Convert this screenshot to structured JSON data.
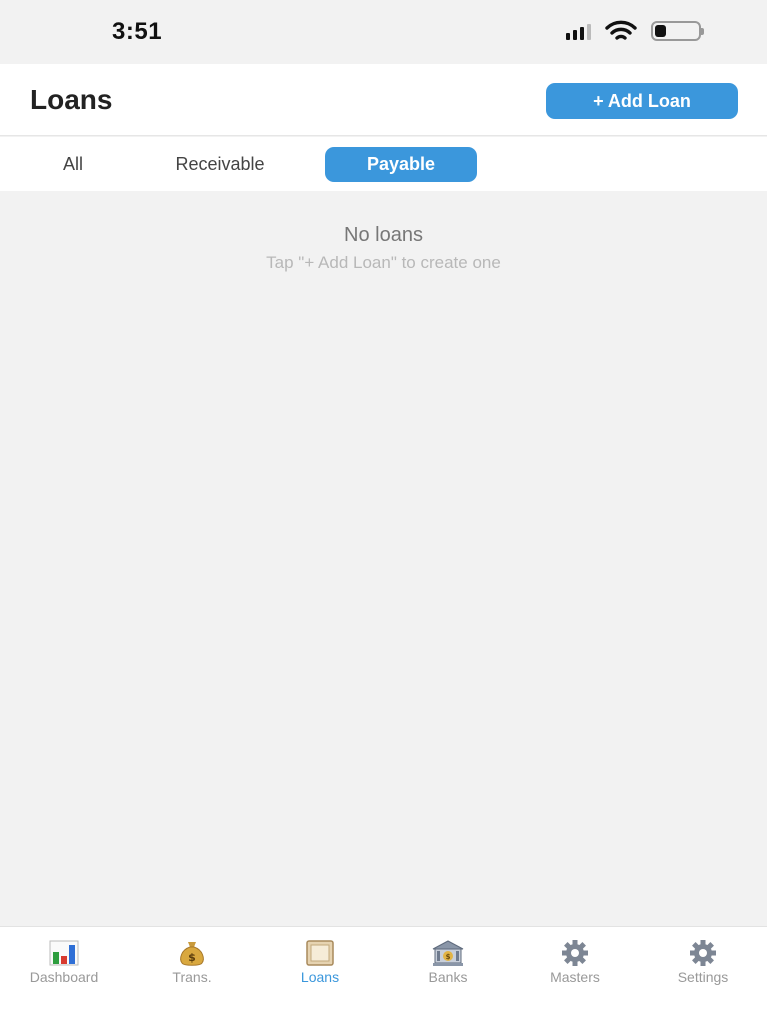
{
  "status_bar": {
    "time": "3:51"
  },
  "header": {
    "title": "Loans",
    "add_button_label": "+ Add Loan"
  },
  "filter_tabs": [
    {
      "label": "All",
      "selected": false
    },
    {
      "label": "Receivable",
      "selected": false
    },
    {
      "label": "Payable",
      "selected": true
    }
  ],
  "empty_state": {
    "title": "No loans",
    "hint": "Tap \"+ Add Loan\" to create one"
  },
  "tab_bar": [
    {
      "label": "Dashboard",
      "icon": "bar-chart-icon",
      "active": false
    },
    {
      "label": "Trans.",
      "icon": "money-bag-icon",
      "active": false
    },
    {
      "label": "Loans",
      "icon": "ledger-icon",
      "active": true
    },
    {
      "label": "Banks",
      "icon": "bank-icon",
      "active": false
    },
    {
      "label": "Masters",
      "icon": "gear-icon",
      "active": false
    },
    {
      "label": "Settings",
      "icon": "gear-icon",
      "active": false
    }
  ],
  "colors": {
    "accent": "#3b97dc",
    "background": "#f2f2f2"
  }
}
